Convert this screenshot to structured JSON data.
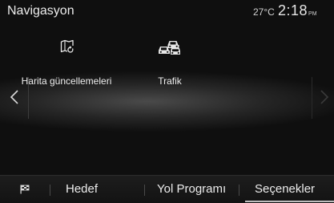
{
  "status_bar": {
    "app_title": "Navigasyon",
    "temperature": "27°C",
    "time": "2:18",
    "time_suffix": "PM"
  },
  "menu": {
    "items": [
      {
        "label": "Harita güncellemeleri",
        "icon": "map-update-icon"
      },
      {
        "label": "Trafik",
        "icon": "traffic-cars-icon"
      }
    ]
  },
  "navigation_arrows": {
    "left": "chevron-left-icon",
    "right": "chevron-right-icon"
  },
  "tab_bar": {
    "flag_icon": "checkered-flag-icon",
    "tabs": [
      {
        "label": "Hedef"
      },
      {
        "label": "Yol Programı"
      },
      {
        "label": "Seçenekler",
        "selected": true
      }
    ]
  }
}
